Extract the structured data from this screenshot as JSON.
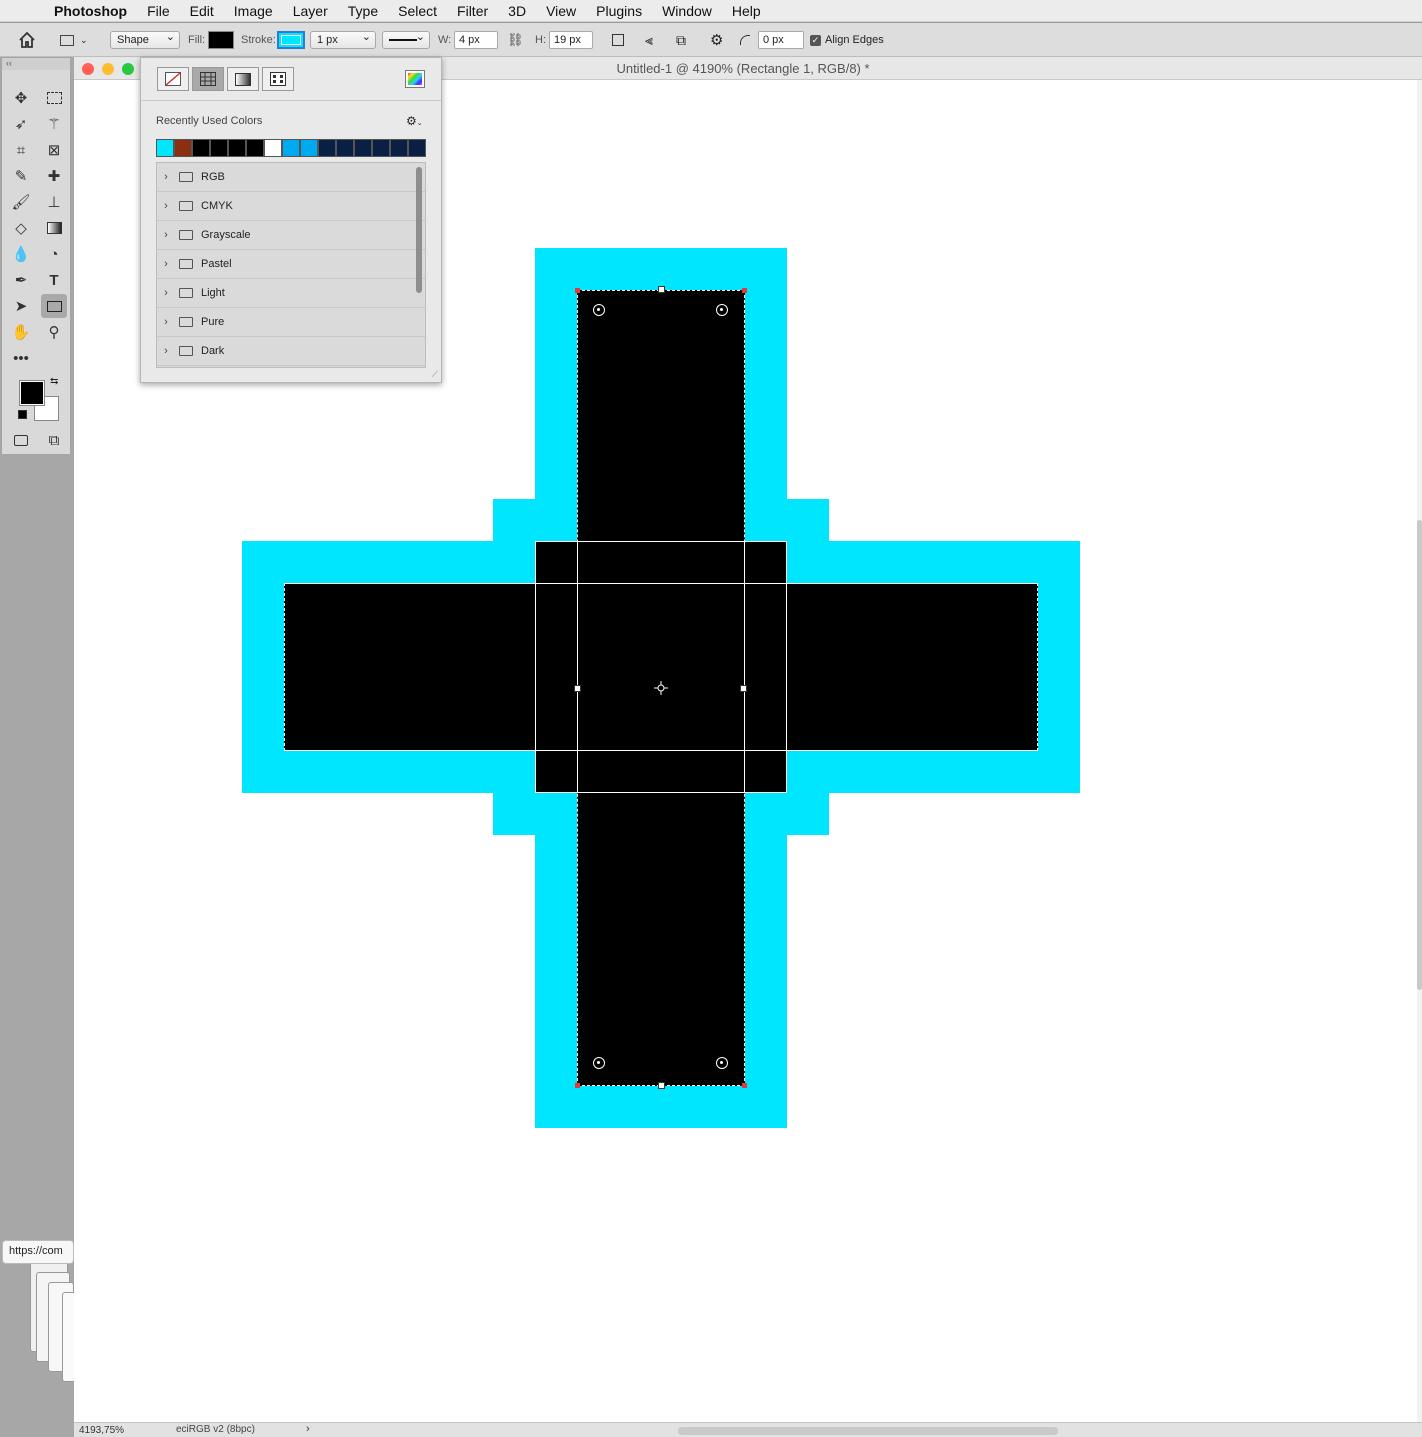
{
  "menubar": {
    "apple": "",
    "items": [
      "Photoshop",
      "File",
      "Edit",
      "Image",
      "Layer",
      "Type",
      "Select",
      "Filter",
      "3D",
      "View",
      "Plugins",
      "Window",
      "Help"
    ]
  },
  "options": {
    "mode": "Shape",
    "fill_label": "Fill:",
    "fill_color": "#000000",
    "stroke_label": "Stroke:",
    "stroke_color": "#00e6ff",
    "stroke_width": "1 px",
    "w_label": "W:",
    "w_value": "4 px",
    "h_label": "H:",
    "h_value": "19 px",
    "corner_value": "0 px",
    "align_edges_label": "Align Edges",
    "align_edges_checked": true
  },
  "document": {
    "title": "Untitled-1 @ 4190% (Rectangle 1, RGB/8) *",
    "zoom": "4193,75%",
    "profile": "eciRGB v2 (8bpc)"
  },
  "url_tooltip": "https://com",
  "swatch_popup": {
    "recent_label": "Recently Used Colors",
    "recent_colors": [
      "#00e6ff",
      "#8a2f10",
      "#000000",
      "#000000",
      "#000000",
      "#000000",
      "#ffffff",
      "#00aaf0",
      "#00aaf0",
      "#0a1f44",
      "#0a1f44",
      "#0a1f44",
      "#0a1f44",
      "#0a1f44",
      "#0a1f44"
    ],
    "groups": [
      "RGB",
      "CMYK",
      "Grayscale",
      "Pastel",
      "Light",
      "Pure",
      "Dark"
    ]
  },
  "colors": {
    "shape_stroke": "#00e6ff",
    "shape_fill": "#000000",
    "foreground": "#000000",
    "background": "#ffffff"
  }
}
